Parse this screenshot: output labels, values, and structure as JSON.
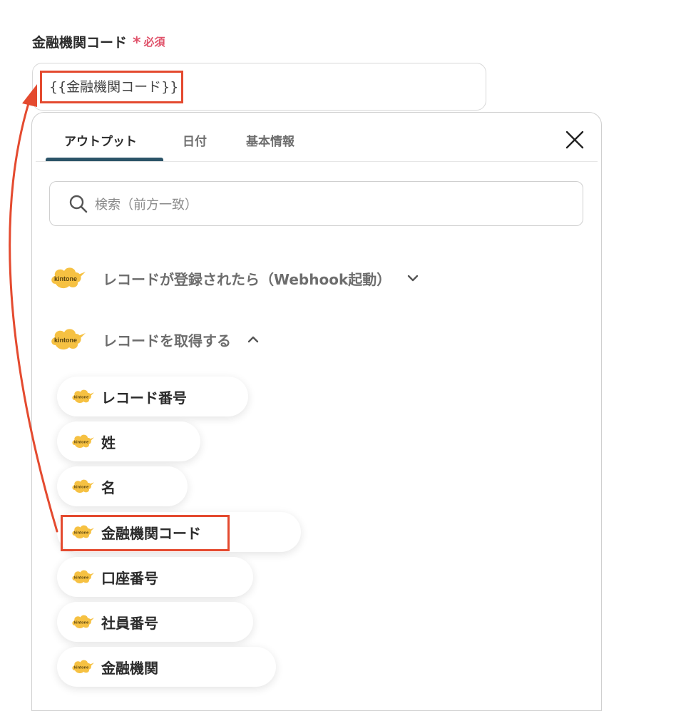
{
  "field": {
    "label": "金融機関コード",
    "required_mark": "*",
    "required_text": "必須",
    "value": "{{金融機関コード}}"
  },
  "panel": {
    "tabs": [
      {
        "label": "アウトプット",
        "active": true
      },
      {
        "label": "日付",
        "active": false
      },
      {
        "label": "基本情報",
        "active": false
      }
    ],
    "close_icon": "close-icon",
    "search": {
      "placeholder": "検索（前方一致）",
      "value": ""
    },
    "groups": [
      {
        "label": "レコードが登録されたら（Webhook起動）",
        "expanded": false,
        "logo_text": "kintone"
      },
      {
        "label": "レコードを取得する",
        "expanded": true,
        "logo_text": "kintone"
      }
    ],
    "items": [
      {
        "label": "レコード番号",
        "logo_text": "kintone"
      },
      {
        "label": "姓",
        "logo_text": "kintone"
      },
      {
        "label": "名",
        "logo_text": "kintone"
      },
      {
        "label": "金融機関コード",
        "logo_text": "kintone",
        "highlighted": true
      },
      {
        "label": "口座番号",
        "logo_text": "kintone"
      },
      {
        "label": "社員番号",
        "logo_text": "kintone"
      },
      {
        "label": "金融機関",
        "logo_text": "kintone"
      }
    ]
  },
  "colors": {
    "accent": "#2c5468",
    "required": "#e0526a",
    "highlight": "#e44a2f",
    "kintone_yellow": "#f6c142"
  }
}
